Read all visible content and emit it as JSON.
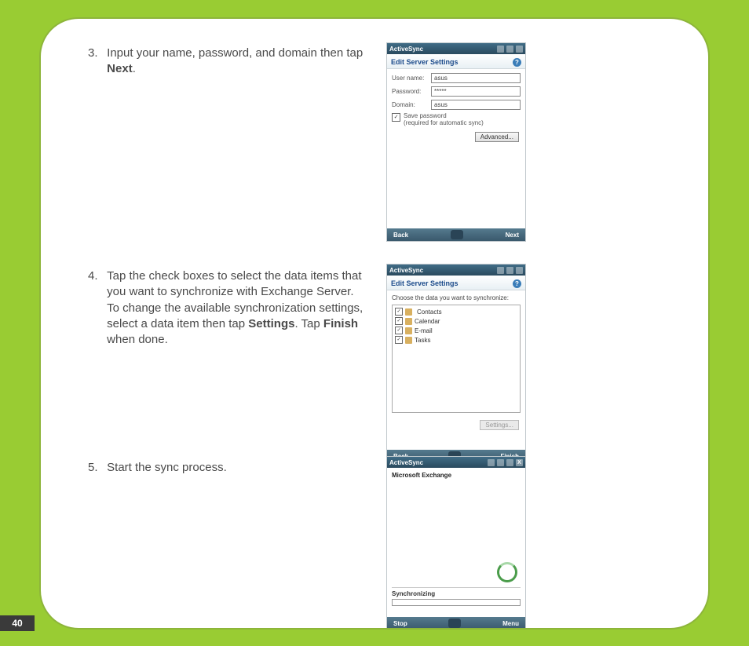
{
  "page_number": "40",
  "steps": {
    "s3": {
      "num": "3.",
      "text_pre": "Input your name, password, and domain then tap ",
      "bold": "Next",
      "text_post": "."
    },
    "s4": {
      "num": "4.",
      "text_a": "Tap the check boxes to select the data items that you want to synchronize with Exchange Server. To change the available synchronization settings, select a data item then tap ",
      "bold1": "Settings",
      "text_b": ". Tap ",
      "bold2": "Finish",
      "text_c": " when done."
    },
    "s5": {
      "num": "5.",
      "text": "Start the sync process."
    }
  },
  "screen1": {
    "title": "ActiveSync",
    "subtitle": "Edit Server Settings",
    "labels": {
      "user": "User name:",
      "password": "Password:",
      "domain": "Domain:"
    },
    "values": {
      "user": "asus",
      "password": "*****",
      "domain": "asus"
    },
    "checkbox": "Save password",
    "checkbox_sub": "(required for automatic sync)",
    "advanced": "Advanced...",
    "soft_left": "Back",
    "soft_right": "Next"
  },
  "screen2": {
    "title": "ActiveSync",
    "subtitle": "Edit Server Settings",
    "prompt": "Choose the data you want to synchronize:",
    "items": [
      "Contacts",
      "Calendar",
      "E-mail",
      "Tasks"
    ],
    "settings_btn": "Settings...",
    "soft_left": "Back",
    "soft_right": "Finish"
  },
  "screen3": {
    "title": "ActiveSync",
    "heading": "Microsoft Exchange",
    "status": "Synchronizing",
    "soft_left": "Stop",
    "soft_right": "Menu"
  },
  "close_x": "X"
}
